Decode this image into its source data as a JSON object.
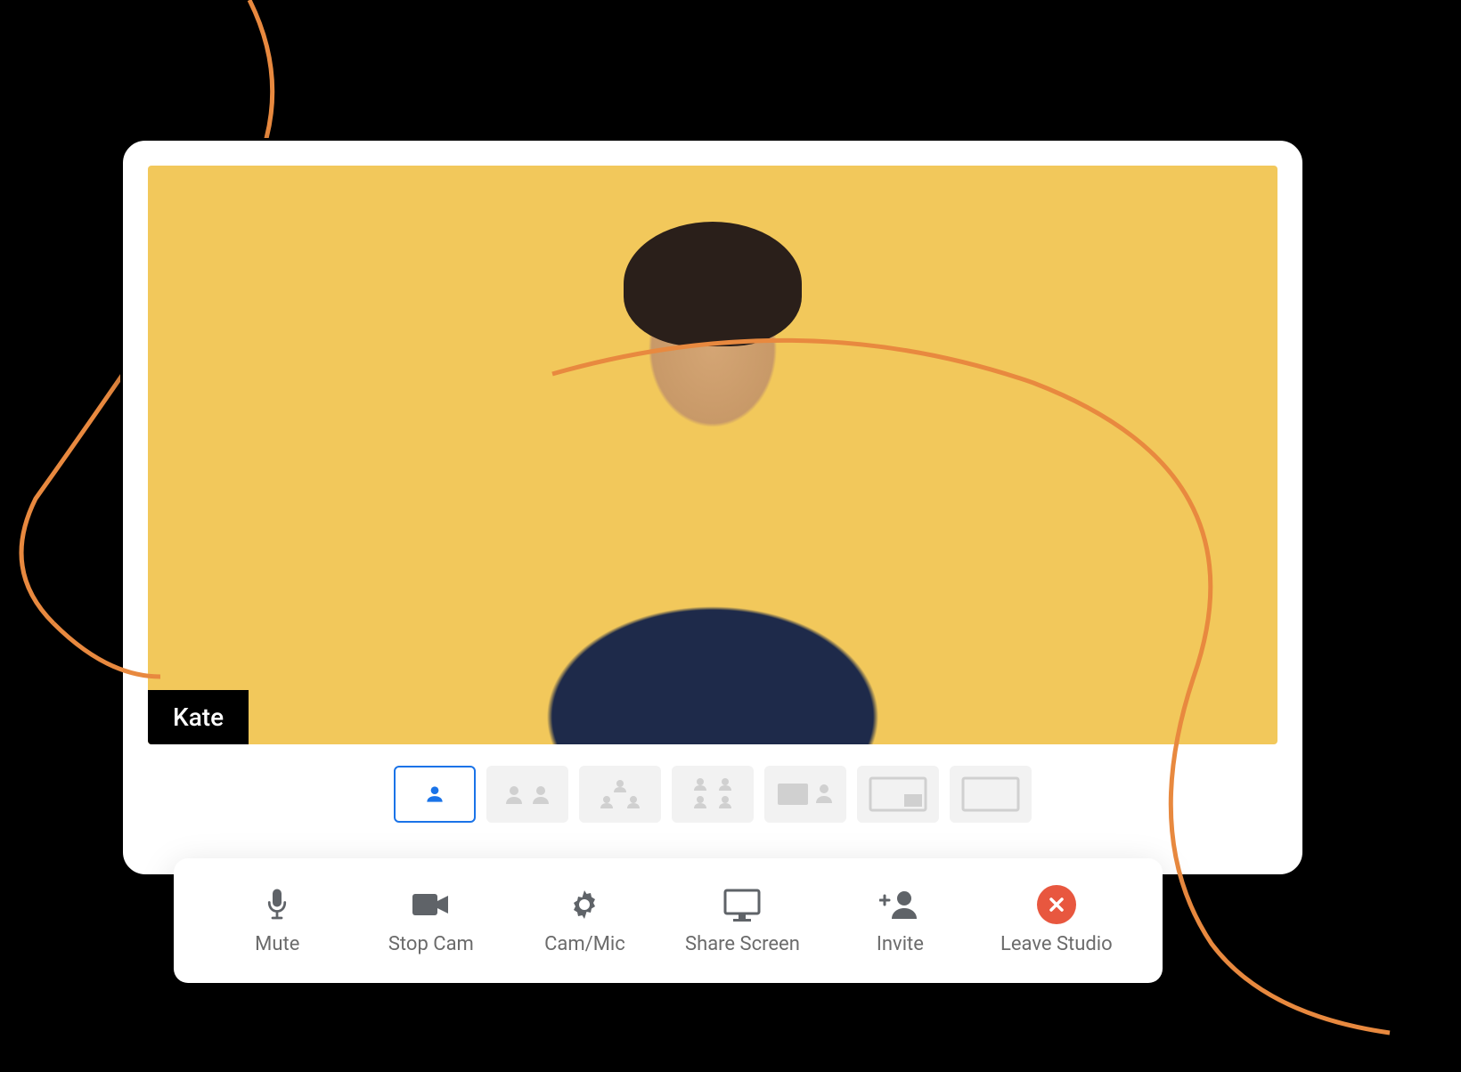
{
  "participant": {
    "name": "Kate"
  },
  "layouts": {
    "options": [
      "single",
      "2up",
      "3up",
      "4grid",
      "1plus1",
      "pip",
      "screen"
    ],
    "active_index": 0
  },
  "toolbar": {
    "mute": {
      "label": "Mute",
      "icon": "mic-icon"
    },
    "stop_cam": {
      "label": "Stop Cam",
      "icon": "camera-icon"
    },
    "cam_mic": {
      "label": "Cam/Mic",
      "icon": "gear-icon"
    },
    "share_screen": {
      "label": "Share Screen",
      "icon": "screen-icon"
    },
    "invite": {
      "label": "Invite",
      "icon": "add-user-icon"
    },
    "leave": {
      "label": "Leave Studio",
      "icon": "close-icon"
    }
  },
  "colors": {
    "video_bg": "#f2c85b",
    "accent_blue": "#1a73e8",
    "leave_red": "#e8573f",
    "swoosh": "#e8893f",
    "icon_gray": "#5f6368"
  }
}
